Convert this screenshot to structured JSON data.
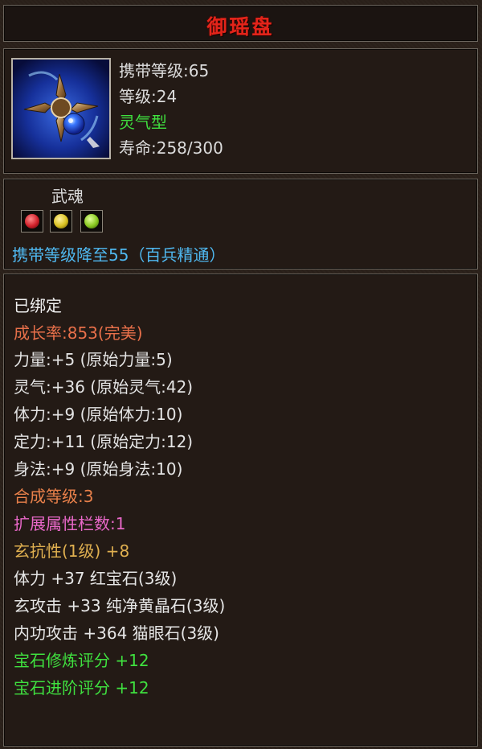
{
  "item": {
    "name": "御瑶盘",
    "name_color": "#e3241a",
    "icon": "cross-shuriken-blue-gem-icon"
  },
  "header": {
    "carry_level": "携带等级:65",
    "level": "等级:24",
    "type": "灵气型",
    "life": "寿命:258/300"
  },
  "weapon_soul": {
    "title": "武魂",
    "gems": [
      {
        "icon": "red-soul-gem-icon",
        "color": "#d0202a"
      },
      {
        "icon": "yellow-soul-gem-icon",
        "color": "#d8c020"
      },
      {
        "icon": "green-soul-gem-icon",
        "color": "#88c820"
      }
    ],
    "note": "携带等级降至55（百兵精通）"
  },
  "attributes": {
    "bound": "已绑定",
    "growth": "成长率:853(完美)",
    "stats": [
      "力量:+5  (原始力量:5)",
      "灵气:+36  (原始灵气:42)",
      "体力:+9  (原始体力:10)",
      "定力:+11  (原始定力:12)",
      "身法:+9  (原始身法:10)"
    ],
    "synthesis_level": "合成等级:3",
    "extend_slots": "扩展属性栏数:1",
    "resistance": "玄抗性(1级) +8",
    "gems": [
      "体力 +37  红宝石(3级)",
      "玄攻击 +33  纯净黄晶石(3级)",
      "内功攻击 +364  猫眼石(3级)"
    ],
    "scores": [
      "宝石修炼评分  +12",
      "宝石进阶评分  +12"
    ]
  }
}
